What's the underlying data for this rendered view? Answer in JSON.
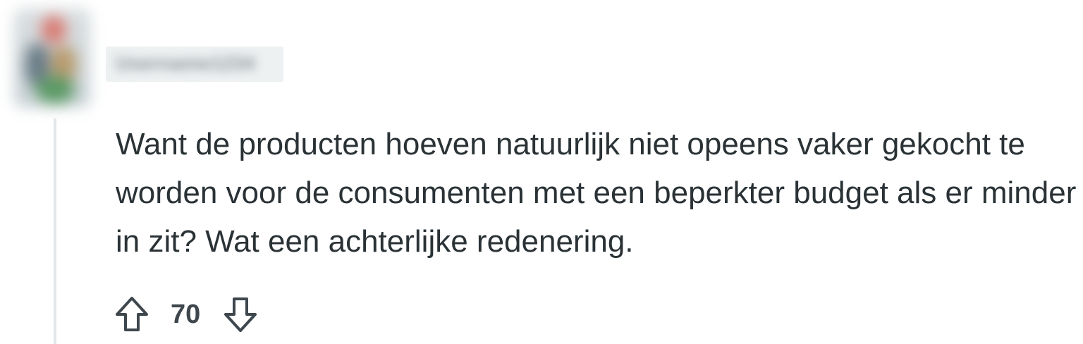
{
  "comment": {
    "author": {
      "username": "Username1234",
      "avatar_icon": "user-avatar"
    },
    "body": "Want de producten hoeven natuurlijk niet opeens vaker gekocht te worden voor de consumenten met een beperkter budget als er minder in zit? Wat een achterlijke redenering.",
    "votes": {
      "score": "70",
      "upvote_icon": "arrow-up-outline-icon",
      "downvote_icon": "arrow-down-outline-icon"
    }
  },
  "colors": {
    "text": "#2a3236",
    "vote_text": "#3e474d",
    "thread_line": "#e3e6e8",
    "username_blur_bg": "#eef1f2"
  }
}
